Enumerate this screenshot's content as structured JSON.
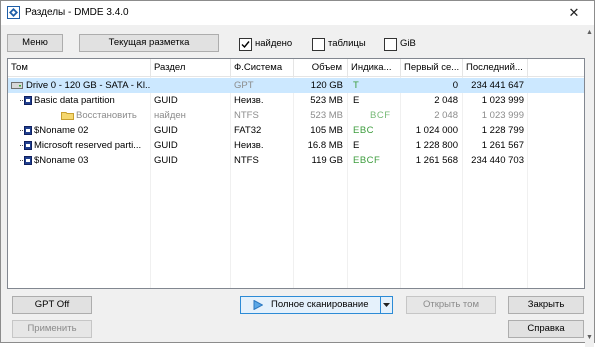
{
  "window": {
    "title": "Разделы - DMDE 3.4.0",
    "close_glyph": "✕"
  },
  "toolbar": {
    "menu_label": "Меню",
    "layout_label": "Текущая разметка",
    "found": {
      "label": "найдено",
      "checked": true
    },
    "tables": {
      "label": "таблицы",
      "checked": false
    },
    "gib": {
      "label": "GiB",
      "checked": false
    }
  },
  "columns": [
    "Том",
    "Раздел",
    "Ф.Система",
    "Объем",
    "Индика...",
    "Первый се...",
    "Последний..."
  ],
  "rows": [
    {
      "tom": "Drive 0 - 120 GB - SATA - Kl...",
      "part": "",
      "fs": "GPT",
      "size": "120 GB",
      "ind": "T",
      "first": "0",
      "last": "234 441 647",
      "icon": "hard-drive-icon",
      "selected": true
    },
    {
      "tom": "Basic data partition",
      "part": "GUID",
      "fs": "Неизв.",
      "size": "523 MB",
      "ind": "E",
      "first": "2 048",
      "last": "1 023 999",
      "icon": "partition-icon"
    },
    {
      "tom": "Восстановить",
      "part": "найден",
      "fs": "NTFS",
      "size": "523 MB",
      "ind": "BCF",
      "first": "2 048",
      "last": "1 023 999",
      "icon": "folder-icon"
    },
    {
      "tom": "$Noname 02",
      "part": "GUID",
      "fs": "FAT32",
      "size": "105 MB",
      "ind": "EBC",
      "first": "1 024 000",
      "last": "1 228 799",
      "icon": "partition-icon"
    },
    {
      "tom": "Microsoft reserved parti...",
      "part": "GUID",
      "fs": "Неизв.",
      "size": "16.8 MB",
      "ind": "E",
      "first": "1 228 800",
      "last": "1 261 567",
      "icon": "partition-icon"
    },
    {
      "tom": "$Noname 03",
      "part": "GUID",
      "fs": "NTFS",
      "size": "119 GB",
      "ind": "EBCF",
      "first": "1 261 568",
      "last": "234 440 703",
      "icon": "partition-icon"
    }
  ],
  "buttons": {
    "gpt_off": "GPT Off",
    "apply": "Применить",
    "full_scan": "Полное сканирование",
    "open_volume": "Открыть том",
    "close": "Закрыть",
    "help": "Справка"
  },
  "colors": {
    "selection": "#cce8ff",
    "indicator_green": "#3c9c3c",
    "dimmed": "#8c8c8c",
    "accent": "#0078d7"
  }
}
